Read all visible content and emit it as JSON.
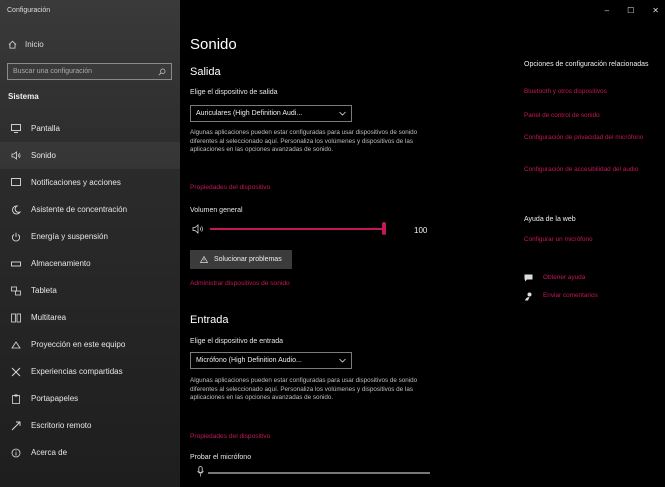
{
  "window": {
    "title": "Configuración",
    "minimize": "–",
    "maximize": "☐",
    "close": "✕"
  },
  "sidebar": {
    "home_label": "Inicio",
    "search_placeholder": "Buscar una configuración",
    "section_heading": "Sistema",
    "items": [
      {
        "label": "Pantalla",
        "icon": "monitor-icon"
      },
      {
        "label": "Sonido",
        "icon": "speaker-icon"
      },
      {
        "label": "Notificaciones y acciones",
        "icon": "notification-icon"
      },
      {
        "label": "Asistente de concentración",
        "icon": "moon-icon"
      },
      {
        "label": "Energía y suspensión",
        "icon": "power-icon"
      },
      {
        "label": "Almacenamiento",
        "icon": "storage-icon"
      },
      {
        "label": "Tableta",
        "icon": "tablet-icon"
      },
      {
        "label": "Multitarea",
        "icon": "multitask-icon"
      },
      {
        "label": "Proyección en este equipo",
        "icon": "projection-icon"
      },
      {
        "label": "Experiencias compartidas",
        "icon": "shared-icon"
      },
      {
        "label": "Portapapeles",
        "icon": "clipboard-icon"
      },
      {
        "label": "Escritorio remoto",
        "icon": "remote-icon"
      },
      {
        "label": "Acerca de",
        "icon": "info-icon"
      }
    ]
  },
  "main": {
    "title": "Sonido",
    "output": {
      "heading": "Salida",
      "device_label": "Elige el dispositivo de salida",
      "device_value": "Auriculares (High Definition Audi...",
      "description": "Algunas aplicaciones pueden estar configuradas para usar dispositivos de sonido diferentes al seleccionado aquí. Personaliza los volúmenes y dispositivos de las aplicaciones en las opciones avanzadas de sonido.",
      "properties_link": "Propiedades del dispositivo",
      "volume_label": "Volumen general",
      "volume_value": "100",
      "volume_level": 1.0,
      "troubleshoot_label": "Solucionar problemas",
      "manage_link": "Administrar dispositivos de sonido"
    },
    "input": {
      "heading": "Entrada",
      "device_label": "Elige el dispositivo de entrada",
      "device_value": "Micrófono (High Definition Audio...",
      "description": "Algunas aplicaciones pueden estar configuradas para usar dispositivos de sonido diferentes al seleccionado aquí. Personaliza los volúmenes y dispositivos de las aplicaciones en las opciones avanzadas de sonido.",
      "properties_link": "Propiedades del dispositivo",
      "test_label": "Probar el micrófono",
      "mic_level": 0.0
    }
  },
  "related": {
    "heading": "Opciones de configuración relacionadas",
    "links": [
      "Bluetooth y otros dispositivos",
      "Panel de control de sonido",
      "Configuración de privacidad del micrófono",
      "Configuración de accesibilidad del audio"
    ],
    "help_heading": "Ayuda de la web",
    "help_link": "Configurar un micrófono",
    "get_help": "Obtener ayuda",
    "feedback": "Enviar comentarios"
  },
  "colors": {
    "accent": "#c2185b",
    "background": "#000000",
    "sidebar": "#2b2b2b"
  }
}
